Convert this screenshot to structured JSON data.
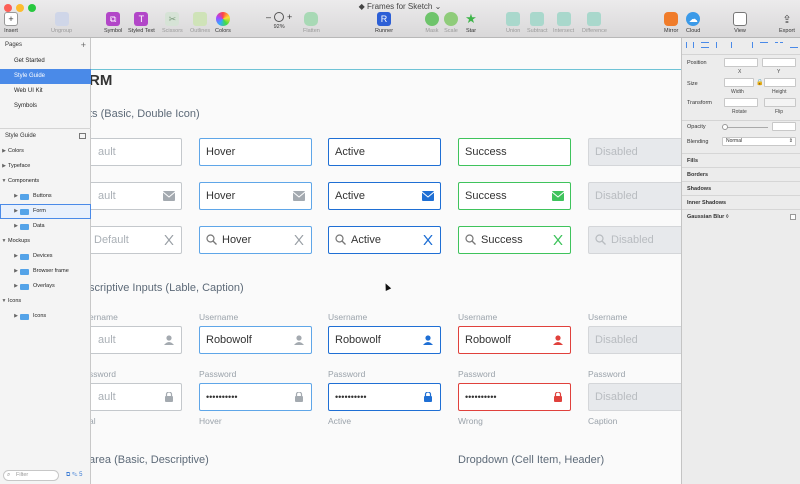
{
  "window": {
    "title": "Frames for Sketch"
  },
  "toolbar": {
    "insert": "Insert",
    "ungroup": "Ungroup",
    "symbol": "Symbol",
    "styled_text": "Styled Text",
    "scissors": "Scissors",
    "outlines": "Outlines",
    "colors": "Colors",
    "zoom": "92%",
    "flatten": "Flatten",
    "runner": "Runner",
    "mask": "Mask",
    "scale": "Scale",
    "star": "Star",
    "union": "Union",
    "subtract": "Subtract",
    "intersect": "Intersect",
    "difference": "Difference",
    "mirror": "Mirror",
    "cloud": "Cloud",
    "view": "View",
    "export": "Export",
    "zoom_minus": "–",
    "zoom_plus": "+"
  },
  "sidebar": {
    "pages_header": "Pages",
    "pages": [
      "Get Started",
      "Style Guide",
      "Web UI Kit",
      "Symbols"
    ],
    "layers_header": "Style Guide",
    "layers": [
      {
        "label": "Colors",
        "level": 0
      },
      {
        "label": "Typeface",
        "level": 0
      },
      {
        "label": "Components",
        "level": 0,
        "open": true
      },
      {
        "label": "Buttons",
        "level": 1
      },
      {
        "label": "Form",
        "level": 1,
        "selected": true
      },
      {
        "label": "Data",
        "level": 1
      },
      {
        "label": "Mockups",
        "level": 0,
        "open": true
      },
      {
        "label": "Devices",
        "level": 1
      },
      {
        "label": "Browser frame",
        "level": 1
      },
      {
        "label": "Overlays",
        "level": 1
      },
      {
        "label": "Icons",
        "level": 0,
        "open": true
      },
      {
        "label": "Icons",
        "level": 1
      }
    ],
    "filter_placeholder": "Filter"
  },
  "canvas": {
    "title": "RM",
    "section1": "ts (Basic, Double Icon)",
    "section2": "scriptive Inputs (Lable, Caption)",
    "section3": "area (Basic, Descriptive)",
    "section4": "Dropdown (Cell Item, Header)",
    "row1": [
      "ault",
      "Hover",
      "Active",
      "Success",
      "Disabled"
    ],
    "row2": [
      "ault",
      "Hover",
      "Active",
      "Success",
      "Disabled"
    ],
    "row3": [
      "Default",
      "Hover",
      "Active",
      "Success",
      "Disabled"
    ],
    "label_username": "Username",
    "label_username_cut": "ername",
    "label_password": "Password",
    "label_password_cut": "ssword",
    "row4": [
      "ault",
      "Robowolf",
      "Robowolf",
      "Robowolf",
      "Disabled"
    ],
    "row5": [
      "ault",
      "••••••••••",
      "••••••••••",
      "••••••••••",
      "Disabled"
    ],
    "captions": [
      "al",
      "Hover",
      "Active",
      "Wrong",
      "Caption"
    ]
  },
  "inspector": {
    "position": "Position",
    "x": "X",
    "y": "Y",
    "size": "Size",
    "width": "Width",
    "height": "Height",
    "transform": "Transform",
    "rotate": "Rotate",
    "flip": "Flip",
    "opacity": "Opacity",
    "blending": "Blending",
    "blending_value": "Normal",
    "fills": "Fills",
    "borders": "Borders",
    "shadows": "Shadows",
    "inner_shadows": "Inner Shadows",
    "gaussian_blur": "Gaussian Blur ◊"
  },
  "colors": {
    "accent": "#4a8ae8",
    "active": "#1f6fd4",
    "success": "#3fc35c",
    "wrong": "#e0413c"
  }
}
